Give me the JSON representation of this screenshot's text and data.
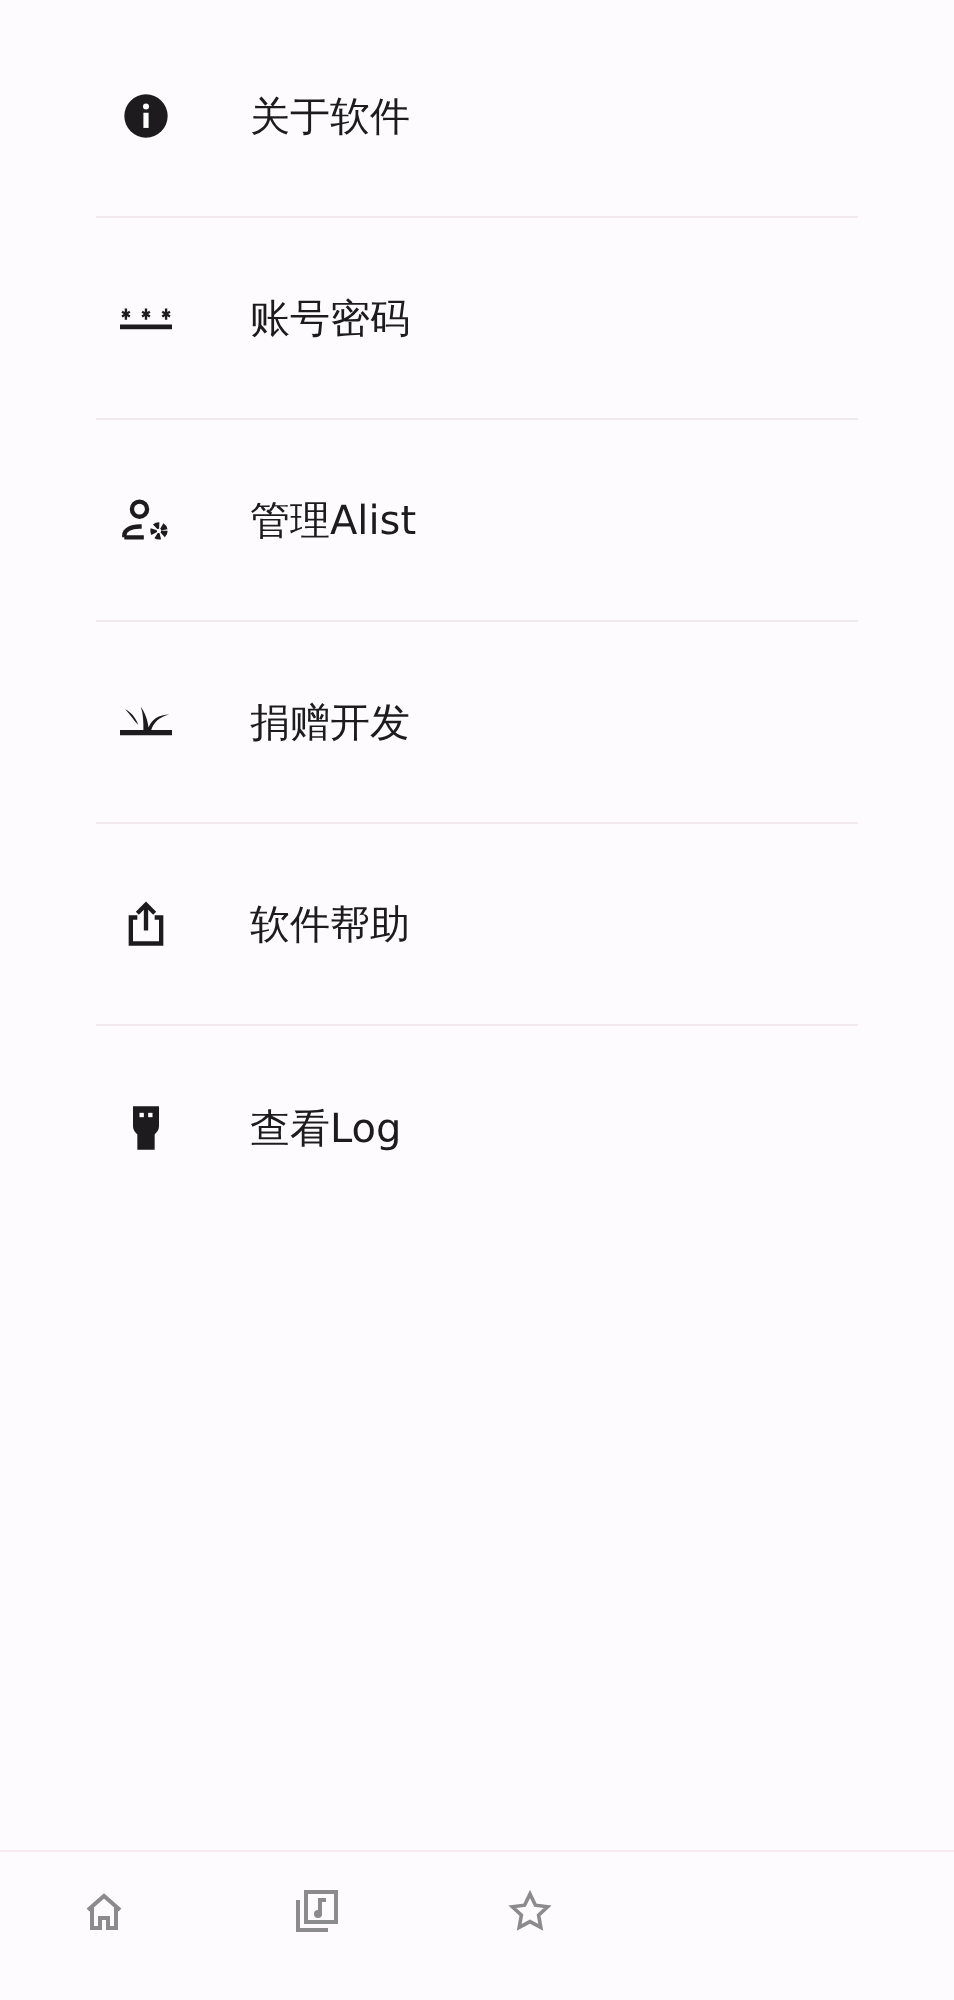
{
  "menu_items": [
    {
      "label": "关于软件"
    },
    {
      "label": "账号密码"
    },
    {
      "label": "管理Alist"
    },
    {
      "label": "捐赠开发"
    },
    {
      "label": "软件帮助"
    },
    {
      "label": "查看Log"
    }
  ]
}
